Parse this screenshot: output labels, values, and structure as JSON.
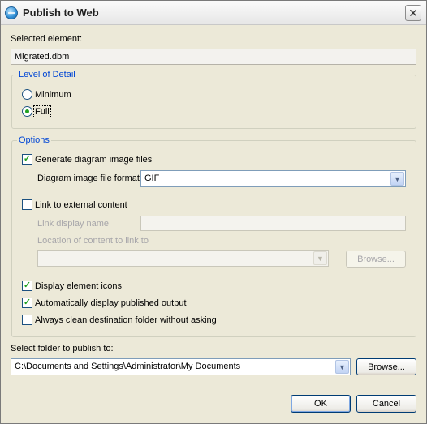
{
  "window": {
    "title": "Publish to Web",
    "app_icon": "globe-icon",
    "close_symbol": "✕"
  },
  "selected_element": {
    "label": "Selected element:",
    "value": "Migrated.dbm"
  },
  "level_of_detail": {
    "legend": "Level of Detail",
    "options": [
      {
        "label": "Minimum",
        "selected": false
      },
      {
        "label": "Full",
        "selected": true
      }
    ]
  },
  "options": {
    "legend": "Options",
    "generate_images": {
      "label": "Generate diagram image files",
      "checked": true
    },
    "image_format": {
      "label": "Diagram image file format",
      "value": "GIF"
    },
    "link_external": {
      "label": "Link to external content",
      "checked": false
    },
    "link_display_name": {
      "label": "Link display name",
      "value": ""
    },
    "location": {
      "label": "Location of content to link to",
      "value": "",
      "browse_label": "Browse..."
    },
    "display_icons": {
      "label": "Display element icons",
      "checked": true
    },
    "auto_display": {
      "label": "Automatically display published output",
      "checked": true
    },
    "always_clean": {
      "label": "Always clean destination folder without asking",
      "checked": false
    }
  },
  "publish_folder": {
    "label": "Select folder to publish to:",
    "value": "C:\\Documents and Settings\\Administrator\\My Documents",
    "browse_label": "Browse..."
  },
  "buttons": {
    "ok": "OK",
    "cancel": "Cancel"
  },
  "icons": {
    "dropdown": "▼",
    "checkmark": "✓"
  },
  "colors": {
    "dialog_bg": "#ece9d8",
    "group_legend": "#0046d5",
    "check_mark": "#21a121"
  }
}
